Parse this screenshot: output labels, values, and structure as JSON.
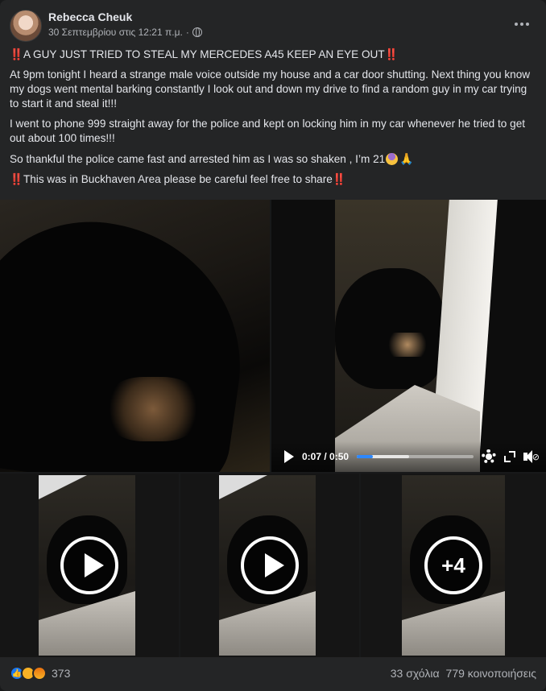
{
  "post": {
    "author": "Rebecca Cheuk",
    "timestamp": "30 Σεπτεμβρίου στις 12:21 π.μ.",
    "separator": "·",
    "privacy_icon": "globe-icon",
    "more_icon": "more-options-icon",
    "headline_prefix": "‼️",
    "headline": "A GUY JUST TRIED TO STEAL MY MERCEDES A45 KEEP AN EYE OUT",
    "headline_suffix": "‼️",
    "paragraph1": "At 9pm tonight I heard a strange male voice outside my house and a car door shutting. Next thing you know my dogs went mental barking constantly I look out and down my drive to find a random guy in my car trying to start it and steal it!!!",
    "paragraph2": "I went to phone 999 straight away for the police and kept on locking him in my car whenever he tried to get out about 100 times!!!",
    "paragraph3": "So thankful the police came fast and arrested him as I was so shaken , I’m 21",
    "paragraph4": "This was in Buckhaven Area please be careful feel free to share"
  },
  "video": {
    "current_time": "0:07",
    "duration": "0:50",
    "time_display": "0:07 / 0:50",
    "progress": 0.14,
    "buffered": 0.45,
    "accent": "#2d88ff"
  },
  "media": {
    "more_count_label": "+4"
  },
  "footer": {
    "reaction_count": "373",
    "comments": "33 σχόλια",
    "shares": "779 κοινοποιήσεις"
  },
  "colors": {
    "background": "#242526",
    "text": "#e4e6eb",
    "secondary_text": "#b0b3b8",
    "alert_red": "#e41e3f"
  }
}
